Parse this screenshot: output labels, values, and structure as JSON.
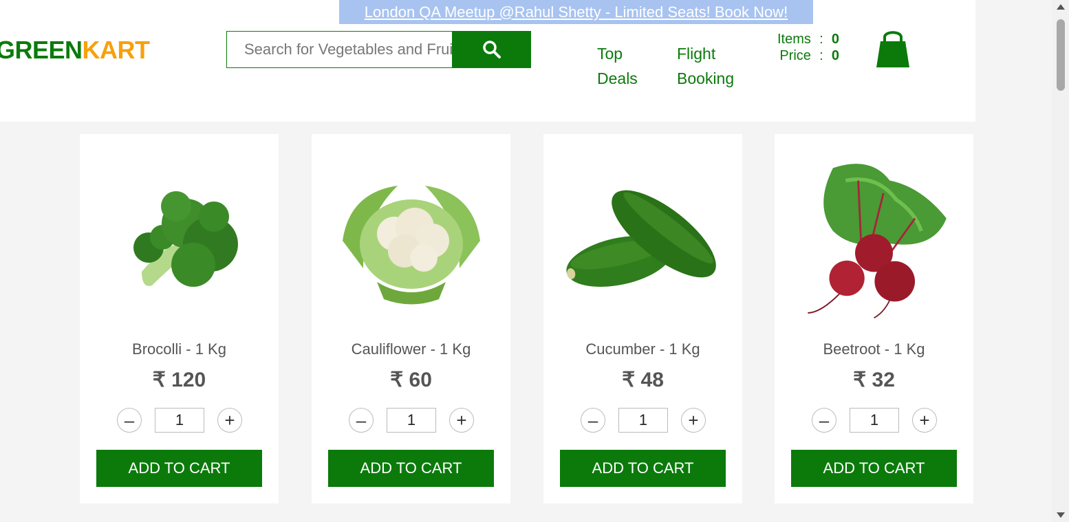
{
  "promo": {
    "text": "London QA Meetup @Rahul Shetty - Limited Seats! Book Now!"
  },
  "brand": {
    "part1": "GREEN",
    "part2": "KART"
  },
  "search": {
    "placeholder": "Search for Vegetables and Fruits",
    "value": ""
  },
  "nav": {
    "top_deals": [
      "Top",
      "Deals"
    ],
    "flight_booking": [
      "Flight",
      "Booking"
    ]
  },
  "cart": {
    "items_label": "Items",
    "items_value": "0",
    "price_label": "Price",
    "price_value": "0",
    "separator": ":"
  },
  "products": [
    {
      "name": "Brocolli - 1 Kg",
      "price": "₹ 120",
      "qty": "1",
      "minus": "–",
      "plus": "+",
      "button": "ADD TO CART",
      "image_icon": "broccoli-icon"
    },
    {
      "name": "Cauliflower - 1 Kg",
      "price": "₹ 60",
      "qty": "1",
      "minus": "–",
      "plus": "+",
      "button": "ADD TO CART",
      "image_icon": "cauliflower-icon"
    },
    {
      "name": "Cucumber - 1 Kg",
      "price": "₹ 48",
      "qty": "1",
      "minus": "–",
      "plus": "+",
      "button": "ADD TO CART",
      "image_icon": "cucumber-icon"
    },
    {
      "name": "Beetroot - 1 Kg",
      "price": "₹ 32",
      "qty": "1",
      "minus": "–",
      "plus": "+",
      "button": "ADD TO CART",
      "image_icon": "beetroot-icon"
    }
  ],
  "colors": {
    "brand_green": "#0b7a0b",
    "brand_orange": "#f6a10b",
    "promo_bg": "#a8c3f0"
  }
}
